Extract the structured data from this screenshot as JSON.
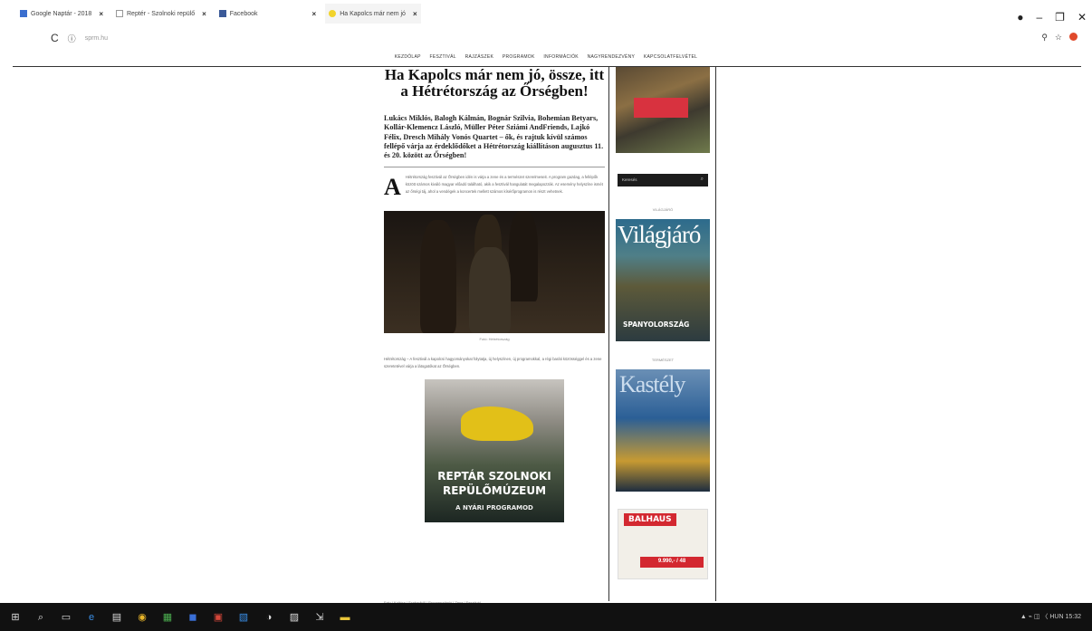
{
  "browser": {
    "tabs": [
      {
        "label": "Google Naptár - 2018",
        "color": "#3b6fcf"
      },
      {
        "label": "Reptér - Szolnoki repülő",
        "color": "#999999"
      },
      {
        "label": "Facebook",
        "color": "#3b5998"
      },
      {
        "label": "Ha Kapolcs már nem jó",
        "color": "#f2d32b"
      }
    ],
    "url": "sprm.hu",
    "window_controls": [
      "●",
      "–",
      "❐",
      "✕"
    ]
  },
  "site": {
    "nav": [
      "KEZDŐLAP",
      "FESZTIVÁL",
      "RAJZÁSZEK",
      "PROGRAMOK",
      "INFORMÁCIÓK",
      "NAGYRENDEZVÉNY",
      "KAPCSOLATFELVÉTEL"
    ]
  },
  "article": {
    "headline": "Ha Kapolcs már nem jó, össze, itt a Hétrétország az Őrségben!",
    "lead": "Lukács Miklós, Balogh Kálmán, Bognár Szilvia, Bohemian Betyars, Kollár-Klemencz László, Müller Péter Sziámi AndFriends, Lajkó Félix, Dresch Mihály Vonós Quartet – ők, és rajtuk kívül számos fellépő várja az érdeklődőket a Hétrétország kiállításon augusztus 11. és 20. között az Őrségben!",
    "dropcap": "A",
    "body": "Hétrétország fesztivál az Őrségben idén is várja a zene és a természet szerelmeseit. A program gazdag, a fellépők között számos kiváló magyar előadó található, akik a fesztivál hangulatát megalapozzák. Az esemény helyszíne ismét az őrségi táj, ahol a vendégek a koncertek mellett számos kísérőprogramon is részt vehetnek.",
    "photo_caption": "Fotó: Hétrétország",
    "body2": "Hétrétország – A fesztivál a kapolcsi hagyományokat folytatja, új helyszínen, új programokkal, a régi baráti közösséggel és a zene szeretetével várja a látogatókat az Őrségben.",
    "ad": {
      "line1": "REPTÁR SZOLNOKI",
      "line2": "REPÜLŐMÚZEUM",
      "line3": "A NYÁRI PROGRAMOD"
    },
    "footer_text": "Falu | Kultúra | Szabadidő | Programajánló | Zene | Fesztivál"
  },
  "sidebar": {
    "search_placeholder": "Keresés",
    "mag1_header": "VILÁGJÁRÓ",
    "mag1_title": "Világjáró",
    "mag1_sub": "SPANYOLORSZÁG",
    "mag2_header": "TERMÉSZET",
    "mag2_title": "Kastély",
    "ad2_logo": "BALHAUS",
    "ad2_price": "9.990,- / 48"
  },
  "taskbar": {
    "icons": [
      "⊞",
      "⌕",
      "▭",
      "e",
      "▤",
      "◉",
      "▦",
      "◼",
      "▣",
      "▧",
      "◑",
      "▨",
      "⇲",
      "▬"
    ],
    "tray_text": "▲ ⌁ ◫ 〈 HUN 15:32"
  }
}
